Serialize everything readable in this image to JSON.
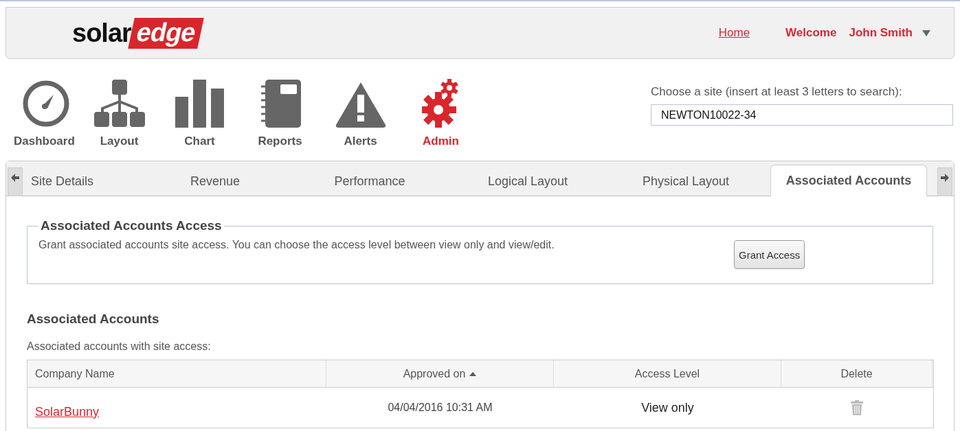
{
  "header": {
    "logo": {
      "dark": "solar",
      "highlight": "edge"
    },
    "home_link": "Home",
    "welcome": "Welcome",
    "user": "John Smith"
  },
  "nav": [
    {
      "label": "Dashboard",
      "selected": false
    },
    {
      "label": "Layout",
      "selected": false
    },
    {
      "label": "Chart",
      "selected": false
    },
    {
      "label": "Reports",
      "selected": false
    },
    {
      "label": "Alerts",
      "selected": false
    },
    {
      "label": "Admin",
      "selected": true
    }
  ],
  "site_chooser": {
    "label": "Choose a site (insert at least 3 letters to search):",
    "value": "NEWTON10022-34"
  },
  "tabs": [
    {
      "label": "Site Details",
      "selected": false
    },
    {
      "label": "Revenue",
      "selected": false
    },
    {
      "label": "Performance",
      "selected": false
    },
    {
      "label": "Logical Layout",
      "selected": false
    },
    {
      "label": "Physical Layout",
      "selected": false
    },
    {
      "label": "Associated Accounts",
      "selected": true
    }
  ],
  "access_section": {
    "legend": "Associated Accounts Access",
    "text": "Grant associated accounts site access. You can choose the access level between view only and view/edit.",
    "button": "Grant Access"
  },
  "accounts": {
    "title": "Associated Accounts",
    "subtitle": "Associated accounts with site access:",
    "columns": [
      {
        "label": "Company Name",
        "sorted": false
      },
      {
        "label": "Approved on",
        "sorted": true
      },
      {
        "label": "Access Level",
        "sorted": false
      },
      {
        "label": "Delete",
        "sorted": false
      }
    ],
    "rows": [
      {
        "company": "SolarBunny",
        "approved_on": "04/04/2016 10:31 AM",
        "access_level": "View only"
      }
    ]
  }
}
